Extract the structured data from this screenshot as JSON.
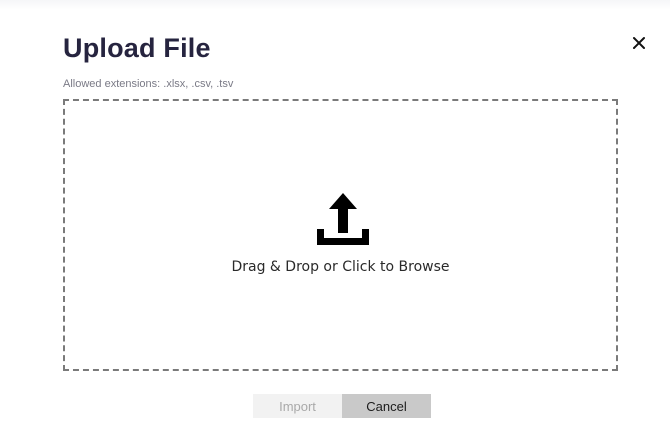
{
  "dialog": {
    "title": "Upload File",
    "subtitle": "Allowed extensions: .xlsx, .csv, .tsv",
    "close_icon": "close-icon",
    "close_glyph": "✕"
  },
  "dropzone": {
    "icon": "upload-icon",
    "label": "Drag & Drop or Click to Browse"
  },
  "actions": {
    "import_label": "Import",
    "cancel_label": "Cancel"
  }
}
